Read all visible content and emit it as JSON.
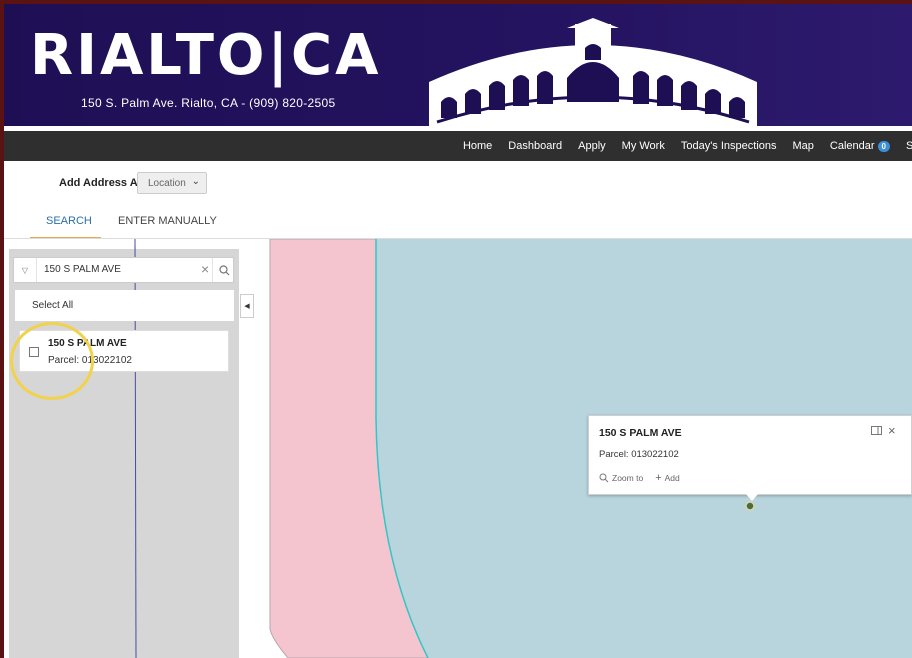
{
  "header": {
    "logo_text": "RIALTO|CA",
    "subtitle": "150 S. Palm Ave. Rialto, CA - (909) 820-2505"
  },
  "nav": {
    "items": [
      "Home",
      "Dashboard",
      "Apply",
      "My Work",
      "Today's Inspections",
      "Map",
      "Calendar"
    ],
    "calendar_count": "0"
  },
  "address_form": {
    "label": "Add Address As",
    "selected": "Location"
  },
  "tabs": [
    {
      "label": "SEARCH",
      "active": true
    },
    {
      "label": "ENTER MANUALLY",
      "active": false
    }
  ],
  "search": {
    "value": "150 S PALM AVE"
  },
  "select_all_label": "Select All",
  "result": {
    "title": "150 S PALM AVE",
    "parcel": "Parcel: 013022102"
  },
  "popup": {
    "title": "150 S PALM AVE",
    "parcel": "Parcel: 013022102",
    "zoom_label": "Zoom to",
    "add_label": "Add"
  },
  "colors": {
    "header_bg": "#1e0f55",
    "nav_bg": "#2f2f2f",
    "accent": "#2a6ea6",
    "parcel_fill": "#b8d4dd",
    "zone_fill": "#f4c5cf",
    "highlight_circle": "#f2d24a"
  }
}
